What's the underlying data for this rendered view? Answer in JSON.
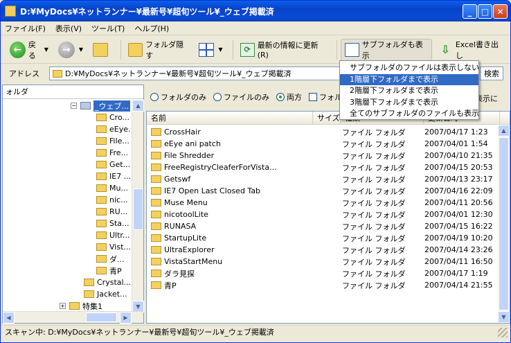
{
  "window": {
    "title": "D:¥MyDocs¥ネットランナー¥最新号¥超旬ツール¥_ウェブ掲載済"
  },
  "menu": [
    "ファイル(F)",
    "表示(V)",
    "ツール(T)",
    "ヘルプ(H)"
  ],
  "toolbar": {
    "back": "戻る",
    "hide_folder": "フォルダ隠す",
    "refresh": "最新の情報に更新(R)",
    "subfolder": "サブフォルダも表示",
    "excel": "Excel書き出し"
  },
  "address": {
    "label": "アドレス",
    "value": "D:¥MyDocs¥ネットランナー¥最新号¥超旬ツール¥_ウェブ掲載済",
    "search": "検索"
  },
  "tree": {
    "header": "ォルダ",
    "selected": "_ウェブ...",
    "children": [
      "Cro...",
      "eEye...",
      "File...",
      "Fre...",
      "Get...",
      "IE7 ...",
      "Mu...",
      "nic...",
      "RU...",
      "Sta...",
      "Ultr...",
      "Vist...",
      "ダ...",
      "青P"
    ],
    "siblings": [
      "Crystal...",
      "Jacket..."
    ],
    "next": "特集1"
  },
  "options": {
    "folders_only": "フォルダのみ",
    "files_only": "ファイルのみ",
    "both": "両方",
    "checkbox": "フォル",
    "right_label": "表示に"
  },
  "list": {
    "headers": [
      "名前",
      "サイズ",
      "種類",
      "更新日時"
    ],
    "rows": [
      {
        "name": "CrossHair",
        "type": "ファイル フォルダ",
        "date": "2007/04/17 1:23"
      },
      {
        "name": "eEye ani patch",
        "type": "ファイル フォルダ",
        "date": "2007/04/01 1:54"
      },
      {
        "name": "File Shredder",
        "type": "ファイル フォルダ",
        "date": "2007/04/10 21:35"
      },
      {
        "name": "FreeRegistryCleaferForVista...",
        "type": "ファイル フォルダ",
        "date": "2007/04/15 20:53"
      },
      {
        "name": "Getswf",
        "type": "ファイル フォルダ",
        "date": "2007/04/13 23:17"
      },
      {
        "name": "IE7 Open Last Closed Tab",
        "type": "ファイル フォルダ",
        "date": "2007/04/16 22:09"
      },
      {
        "name": "Muse Menu",
        "type": "ファイル フォルダ",
        "date": "2007/04/11 20:56"
      },
      {
        "name": "nicotoolLite",
        "type": "ファイル フォルダ",
        "date": "2007/04/01 12:30"
      },
      {
        "name": "RUNASA",
        "type": "ファイル フォルダ",
        "date": "2007/04/15 16:22"
      },
      {
        "name": "StartupLite",
        "type": "ファイル フォルダ",
        "date": "2007/04/19 10:20"
      },
      {
        "name": "UltraExplorer",
        "type": "ファイル フォルダ",
        "date": "2007/04/14 23:26"
      },
      {
        "name": "VistaStartMenu",
        "type": "ファイル フォルダ",
        "date": "2007/04/11 16:50"
      },
      {
        "name": "ダラ見探",
        "type": "ファイル フォルダ",
        "date": "2007/04/17 1:19"
      },
      {
        "name": "青P",
        "type": "ファイル フォルダ",
        "date": "2007/04/14 21:55"
      }
    ]
  },
  "dropdown": {
    "items": [
      "サブフォルダのファイルは表示しない",
      "1階層下フォルダまで表示",
      "2階層下フォルダまで表示",
      "3階層下フォルダまで表示",
      "全てのサブフォルダのファイルも表示"
    ],
    "highlighted_index": 1
  },
  "status": "スキャン中: D:¥MyDocs¥ネットランナー¥最新号¥超旬ツール¥_ウェブ掲載済"
}
